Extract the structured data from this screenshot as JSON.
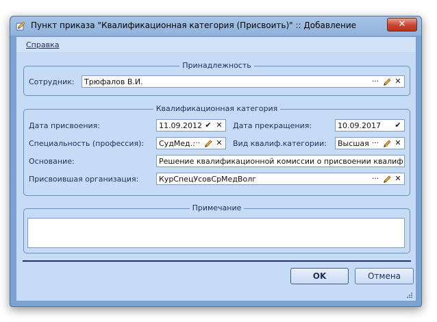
{
  "window": {
    "title": "Пункт приказа \"Квалификационная категория (Присвоить)\" :: Добавление",
    "close_label": "✕"
  },
  "menu": {
    "help_label": "Справка"
  },
  "affiliation": {
    "title": "Принадлежность",
    "employee_label": "Сотрудник:",
    "employee_value": "Трюфалов В.И."
  },
  "qualification": {
    "title": "Квалификационная категория",
    "assign_date_label": "Дата присвоения:",
    "assign_date_value": "11.09.2012",
    "end_date_label": "Дата прекращения:",
    "end_date_value": "10.09.2017",
    "specialty_label": "Специальность (профессия):",
    "specialty_value": "СудМед...",
    "category_type_label": "Вид квалиф.категории:",
    "category_type_value": "Высшая",
    "basis_label": "Основание:",
    "basis_value": "Решение квалификационной комиссии о присвоении квалификационной категории",
    "organization_label": "Присвоившая организация:",
    "organization_value": "КурСпецУсовСрМедВолг"
  },
  "note": {
    "title": "Примечание",
    "value": ""
  },
  "buttons": {
    "ok_label": "OK",
    "cancel_label": "Отмена"
  },
  "icons": {
    "lookup": "ellipsis-icon",
    "edit": "pencil-icon",
    "clear": "clear-x-icon",
    "dropdown": "chevron-down-icon"
  },
  "colors": {
    "frame": "#7aa2d3",
    "client_bg": "#c5dbf6",
    "close_red": "#c9462f",
    "separator": "#1c2f6e"
  }
}
